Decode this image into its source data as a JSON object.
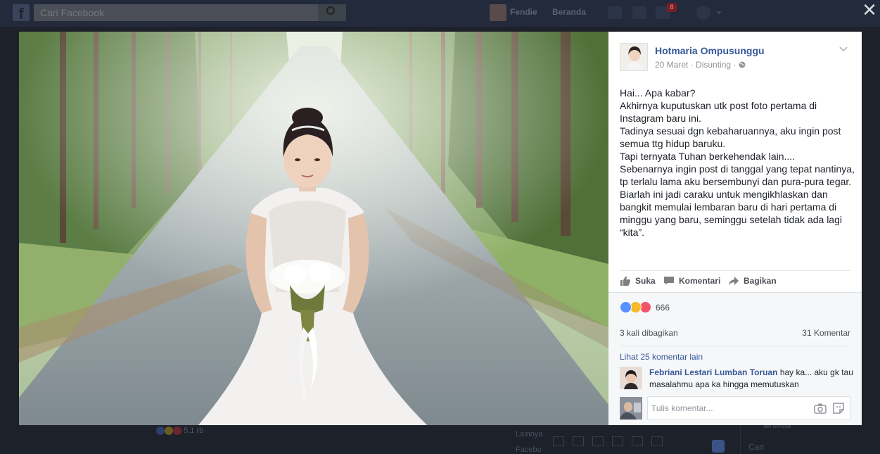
{
  "facebook": {
    "search_placeholder": "Cari Facebook",
    "nav_user": "Fendie",
    "nav_home": "Beranda",
    "notification_count": "8"
  },
  "background": {
    "reaction_count": "5,1 rb",
    "side_text_1": "Lainnya",
    "side_text_2": "Facebo",
    "sidebar_text": "tersedia",
    "sidebar_search": "Cari"
  },
  "post": {
    "author": "Hotmaria Ompusunggu",
    "date": "20 Maret",
    "edited": "Disunting",
    "privacy_icon": "globe-icon",
    "text": "Hai... Apa kabar?\nAkhirnya kuputuskan utk post foto pertama di Instagram baru ini.\nTadinya sesuai dgn kebaharuannya, aku ingin post semua ttg hidup baruku.\nTapi ternyata Tuhan berkehendak lain....\nSebenarnya ingin post di tanggal yang tepat nantinya, tp terlalu lama aku bersembunyi dan pura-pura tegar. Biarlah ini jadi caraku untuk mengikhlaskan dan bangkit memulai lembaran baru di hari pertama di minggu yang baru, seminggu setelah tidak ada lagi “kita”."
  },
  "actions": {
    "like": "Suka",
    "comment": "Komentari",
    "share": "Bagikan"
  },
  "stats": {
    "reactions_count": "666",
    "shares": "3 kali dibagikan",
    "comments": "31 Komentar",
    "reaction_colors": [
      "#5890ff",
      "#f7b928",
      "#f25268"
    ]
  },
  "comments": {
    "view_more": "Lihat 25 komentar lain",
    "items": [
      {
        "author": "Febriani Lestari Lumban Toruan",
        "text": "hay ka... aku gk tau masalahmu apa ka hingga memutuskan"
      }
    ],
    "input_placeholder": "Tulis komentar..."
  }
}
